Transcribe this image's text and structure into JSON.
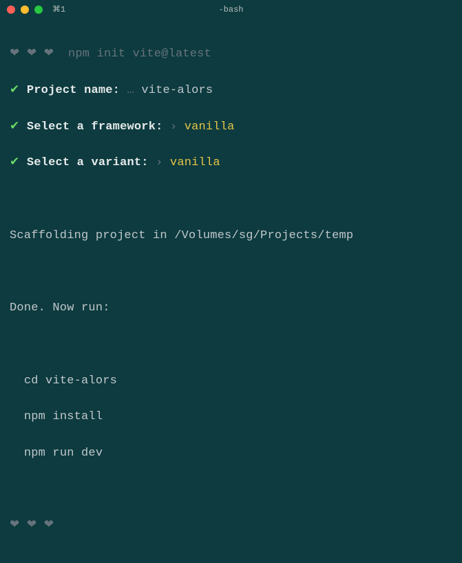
{
  "titlebar": {
    "tab": "⌘1",
    "title": "-bash"
  },
  "prompt": {
    "hearts": "❤︎ ❤︎ ❤︎",
    "command": "npm init vite@latest"
  },
  "lines": {
    "check": "✔",
    "project_name_label": "Project name:",
    "ellipsis": "…",
    "project_name_value": "vite-alors",
    "framework_label": "Select a framework:",
    "chevron": "›",
    "framework_value": "vanilla",
    "variant_label": "Select a variant:",
    "variant_value": "vanilla"
  },
  "scaffold": "Scaffolding project in /Volumes/sg/Projects/temp",
  "done": "Done. Now run:",
  "cmds": {
    "cd": "cd vite-alors",
    "install": "npm install",
    "dev": "npm run dev"
  },
  "prompt2": {
    "hearts": "❤︎ ❤︎ ❤︎"
  }
}
